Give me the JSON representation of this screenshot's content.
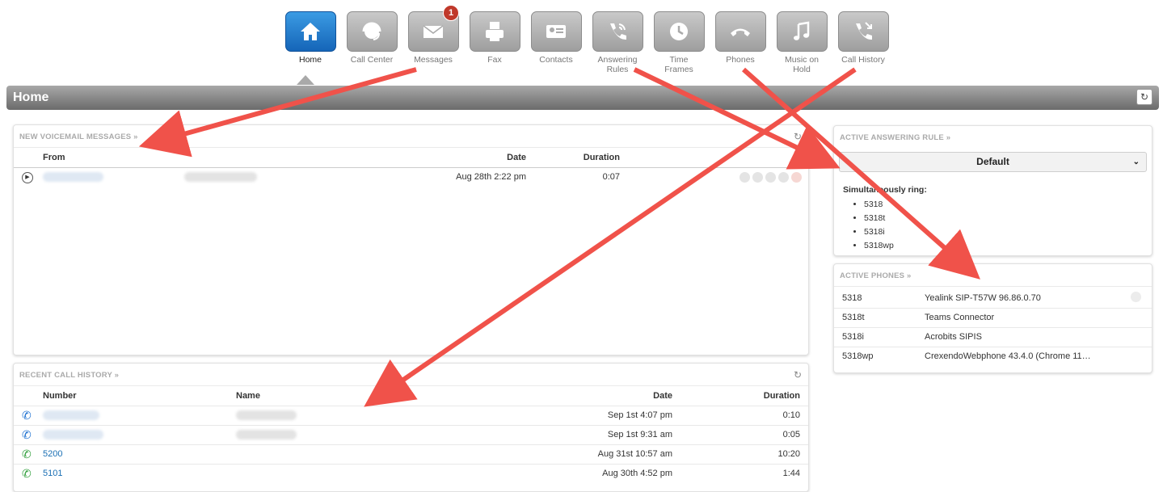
{
  "nav": [
    {
      "label": "Home",
      "icon": "home-icon",
      "active": true
    },
    {
      "label": "Call Center",
      "icon": "headset-icon"
    },
    {
      "label": "Messages",
      "icon": "envelope-icon",
      "badge": "1"
    },
    {
      "label": "Fax",
      "icon": "fax-icon"
    },
    {
      "label": "Contacts",
      "icon": "contact-card-icon"
    },
    {
      "label": "Answering Rules",
      "icon": "phone-rules-icon"
    },
    {
      "label": "Time Frames",
      "icon": "clock-icon"
    },
    {
      "label": "Phones",
      "icon": "handset-icon"
    },
    {
      "label": "Music on Hold",
      "icon": "music-note-icon"
    },
    {
      "label": "Call History",
      "icon": "call-history-icon"
    }
  ],
  "page": {
    "title": "Home"
  },
  "voicemail": {
    "heading": "NEW VOICEMAIL MESSAGES »",
    "col_from": "From",
    "col_date": "Date",
    "col_duration": "Duration",
    "rows": [
      {
        "date": "Aug 28th 2:22 pm",
        "duration": "0:07"
      }
    ]
  },
  "answering": {
    "heading": "ACTIVE ANSWERING RULE »",
    "selected": "Default",
    "ring_label": "Simultaneously ring:",
    "ring_list": [
      "5318",
      "5318t",
      "5318i",
      "5318wp"
    ]
  },
  "phones": {
    "heading": "ACTIVE PHONES »",
    "rows": [
      {
        "ext": "5318",
        "device": "Yealink SIP-T57W 96.86.0.70"
      },
      {
        "ext": "5318t",
        "device": "Teams Connector"
      },
      {
        "ext": "5318i",
        "device": "Acrobits SIPIS"
      },
      {
        "ext": "5318wp",
        "device": "CrexendoWebphone 43.4.0 (Chrome 11…"
      }
    ]
  },
  "history": {
    "heading": "RECENT CALL HISTORY »",
    "col_number": "Number",
    "col_name": "Name",
    "col_date": "Date",
    "col_duration": "Duration",
    "rows": [
      {
        "number": "",
        "date": "Sep 1st 4:07 pm",
        "duration": "0:10",
        "direction": "incoming"
      },
      {
        "number": "",
        "date": "Sep 1st 9:31 am",
        "duration": "0:05",
        "direction": "incoming"
      },
      {
        "number": "5200",
        "date": "Aug 31st 10:57 am",
        "duration": "10:20",
        "direction": "outgoing"
      },
      {
        "number": "5101",
        "date": "Aug 30th 4:52 pm",
        "duration": "1:44",
        "direction": "outgoing"
      }
    ]
  },
  "colors": {
    "accent": "#1a6fb4",
    "arrow": "#f0524a",
    "incoming": "#1a6fd0",
    "outgoing": "#2e9e3a"
  }
}
